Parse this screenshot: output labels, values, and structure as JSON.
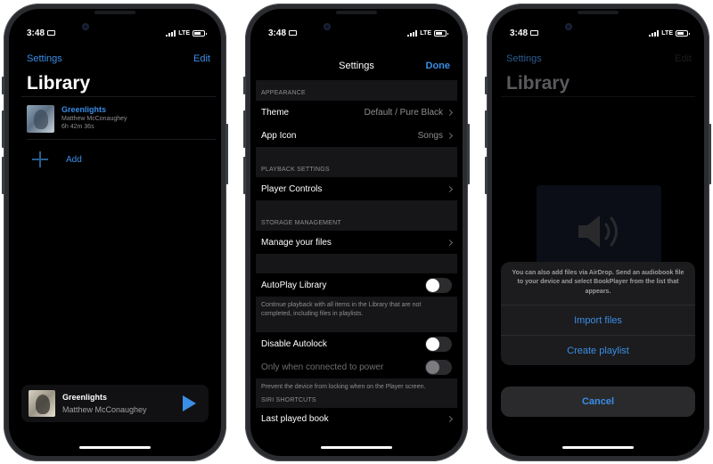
{
  "status_bar": {
    "time": "3:48",
    "network": "LTE"
  },
  "phone1": {
    "nav": {
      "left": "Settings",
      "right": "Edit"
    },
    "title": "Library",
    "books": [
      {
        "title": "Greenlights",
        "author": "Matthew McConaughey",
        "duration": "6h 42m 36s"
      }
    ],
    "add_label": "Add",
    "mini_player": {
      "title": "Greenlights",
      "author": "Matthew McConaughey"
    }
  },
  "phone2": {
    "title": "Settings",
    "done_label": "Done",
    "sections": {
      "appearance": {
        "header": "APPEARANCE",
        "theme": {
          "label": "Theme",
          "value": "Default / Pure Black"
        },
        "app_icon": {
          "label": "App Icon",
          "value": "Songs"
        }
      },
      "playback": {
        "header": "PLAYBACK SETTINGS",
        "player_controls": "Player Controls"
      },
      "storage": {
        "header": "STORAGE MANAGEMENT",
        "manage_files": "Manage your files"
      },
      "autoplay": {
        "label": "AutoPlay Library",
        "enabled": false,
        "note": "Continue playback with all items in the Library that are not completed, including files in playlists."
      },
      "autolock": {
        "label": "Disable Autolock",
        "enabled": false,
        "power_label": "Only when connected to power",
        "power_enabled": false,
        "note": "Prevent the device from locking when on the Player screen."
      },
      "siri": {
        "header": "SIRI SHORTCUTS",
        "last_played": "Last played book"
      }
    }
  },
  "phone3": {
    "nav": {
      "left": "Settings",
      "right": "Edit"
    },
    "title": "Library",
    "sheet": {
      "message": "You can also add files via AirDrop. Send an audiobook file to your device and select BookPlayer from the list that appears.",
      "actions": [
        "Import files",
        "Create playlist"
      ],
      "cancel": "Cancel"
    }
  },
  "colors": {
    "accent": "#3a8ee6",
    "background": "#000000",
    "grouped_bg": "#161618"
  }
}
